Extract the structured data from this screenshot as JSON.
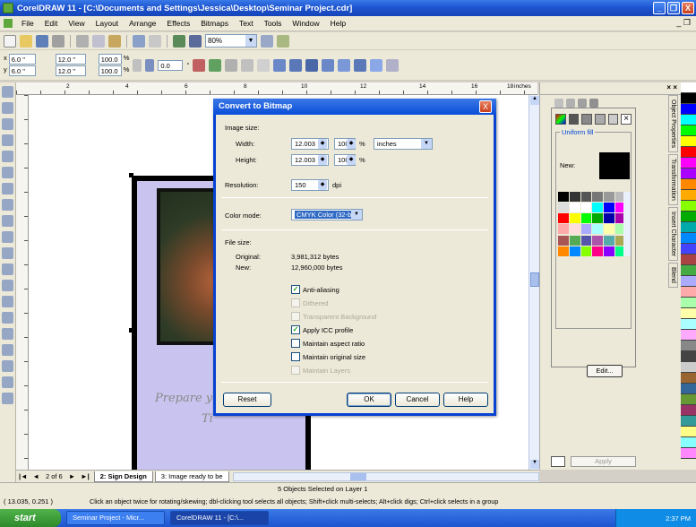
{
  "window": {
    "title": "CorelDRAW 11 - [C:\\Documents and Settings\\Jessica\\Desktop\\Seminar Project.cdr]",
    "min_label": "_",
    "max_label": "❐",
    "close_label": "X"
  },
  "menu": {
    "items": [
      "File",
      "Edit",
      "View",
      "Layout",
      "Arrange",
      "Effects",
      "Bitmaps",
      "Text",
      "Tools",
      "Window",
      "Help"
    ],
    "mdi_controls": "_ ❐"
  },
  "toolbar": {
    "zoom": "80%"
  },
  "propertybar": {
    "x": "6.0 \"",
    "y": "6.0 \"",
    "width": "12.0 \"",
    "height": "12.0 \"",
    "scale_x": "100.0",
    "scale_y": "100.0",
    "pct_x": "%",
    "pct_y": "%",
    "rotation": "0.0",
    "degree": "°"
  },
  "ruler": {
    "ticks": [
      "2",
      "4",
      "6",
      "8",
      "10",
      "12",
      "14",
      "16",
      "18"
    ],
    "unit": "inches"
  },
  "canvas": {
    "script_line1": "Prepare yo",
    "script_line2": "Ti"
  },
  "dialog": {
    "title": "Convert to Bitmap",
    "close_label": "X",
    "image_size_label": "Image size:",
    "width_label": "Width:",
    "width_value": "12.003",
    "width_pct": "100",
    "height_label": "Height:",
    "height_value": "12.003",
    "height_pct": "100",
    "pct_symbol": "%",
    "units": "inches",
    "resolution_label": "Resolution:",
    "resolution_value": "150",
    "dpi": "dpi",
    "color_mode_label": "Color mode:",
    "color_mode_value": "CMYK Color (32-bit)",
    "file_size_label": "File size:",
    "original_label": "Original:",
    "original_value": "3,981,312 bytes",
    "new_label": "New:",
    "new_value": "12,960,000 bytes",
    "options": [
      {
        "label": "Anti-aliasing",
        "checked": true,
        "enabled": true
      },
      {
        "label": "Dithered",
        "checked": false,
        "enabled": false
      },
      {
        "label": "Transparent Background",
        "checked": false,
        "enabled": false
      },
      {
        "label": "Apply ICC profile",
        "checked": true,
        "enabled": true
      },
      {
        "label": "Maintain aspect ratio",
        "checked": false,
        "enabled": true
      },
      {
        "label": "Maintain original size",
        "checked": false,
        "enabled": true
      },
      {
        "label": "Maintain Layers",
        "checked": false,
        "enabled": false
      }
    ],
    "reset_label": "Reset",
    "ok_label": "OK",
    "cancel_label": "Cancel",
    "help_label": "Help"
  },
  "pagebar": {
    "page_count": "2 of 6",
    "tab1": "2: Sign Design",
    "tab2": "3: Image ready to be"
  },
  "docker": {
    "uniform_fill": "Uniform fill",
    "new_label": "New:",
    "edit_label": "Edit...",
    "apply_label": "Apply",
    "tabs": [
      "Object Properties",
      "Transformation",
      "Insert Character",
      "Blend"
    ]
  },
  "status": {
    "selection": "5 Objects Selected on Layer 1",
    "coords": "( 13.035, 0.251 )",
    "hint": "Click an object twice for rotating/skewing; dbl-clicking tool selects all objects; Shift+click multi-selects; Alt+click digs; Ctrl+click selects in a group"
  },
  "taskbar": {
    "start": "start",
    "task1": "Seminar Project - Micr...",
    "task2": "CorelDRAW 11 - [C:\\...",
    "time": "2:37 PM"
  },
  "colors": {
    "xp_blue": "#0a4dd8",
    "page_bg": "#c9c4ef"
  }
}
